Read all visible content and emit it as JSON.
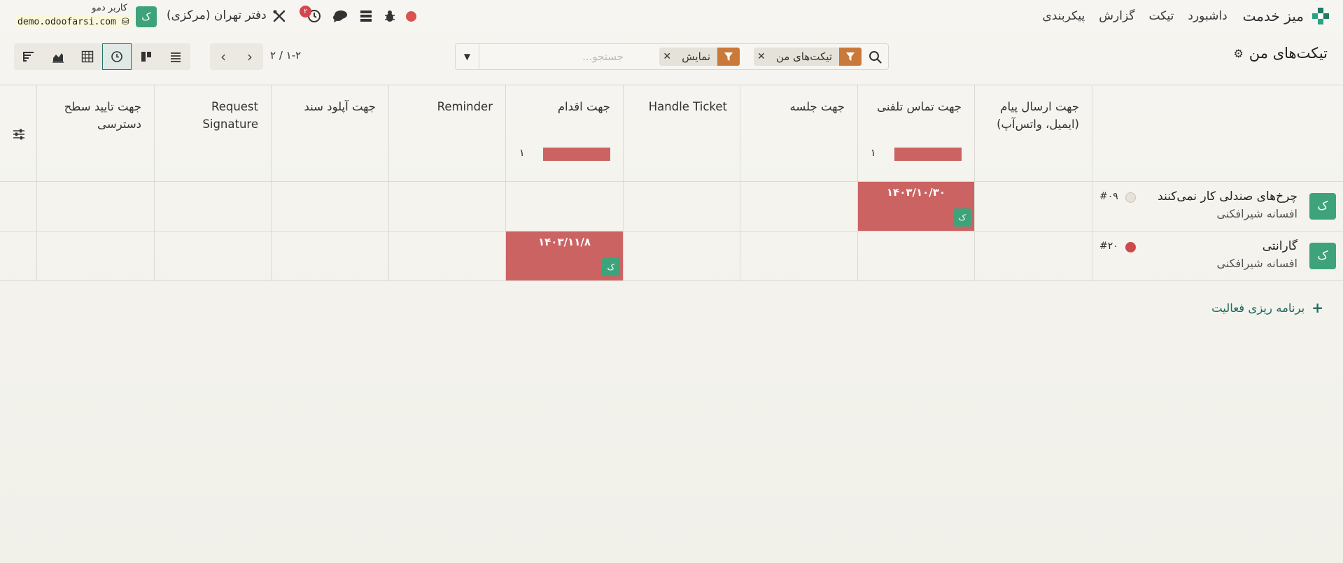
{
  "navbar": {
    "app_name": "میز خدمت",
    "menu": [
      "داشبورد",
      "تیکت",
      "گزارش",
      "پیکربندی"
    ],
    "company": "دفتر تهران (مرکزی)",
    "user_name": "کاربر دمو",
    "user_db": "demo.odoofarsi.com",
    "user_initial": "ک",
    "activity_badge": "۲",
    "colors": {
      "accent": "#3ea37a",
      "facet": "#c9793a",
      "overdue": "#cc6363"
    }
  },
  "control": {
    "title": "تیکت‌های من",
    "search_placeholder": "جستجو...",
    "facets": [
      {
        "label": "تیکت‌های من"
      },
      {
        "label": "نمایش"
      }
    ],
    "pager": "۱-۲ / ۲",
    "views": [
      "list-icon",
      "kanban-icon",
      "activity-icon",
      "pivot-icon",
      "graph-icon",
      "cohort-icon"
    ]
  },
  "grid": {
    "columns": [
      {
        "label": "جهت ارسال پیام (ایمیل، واتس‌آپ)",
        "count": "",
        "progress": 0
      },
      {
        "label": "جهت تماس تلفنی",
        "count": "۱",
        "progress": 1
      },
      {
        "label": "جهت جلسه",
        "count": "",
        "progress": 0
      },
      {
        "label": "Handle Ticket",
        "count": "",
        "progress": 0
      },
      {
        "label": "جهت اقدام",
        "count": "۱",
        "progress": 1
      },
      {
        "label": "Reminder",
        "count": "",
        "progress": 0
      },
      {
        "label": "جهت آپلود سند",
        "count": "",
        "progress": 0
      },
      {
        "label": "Request Signature",
        "count": "",
        "progress": 0
      },
      {
        "label": "جهت تایید سطح دسترسی",
        "count": "",
        "progress": 0
      }
    ],
    "rows": [
      {
        "name": "چرخ‌های صندلی کار نمی‌کنند",
        "customer": "افسانه شیرافکنی",
        "ref": "#۰۹",
        "avatar": "ک",
        "priority_color": "#e6e2d8",
        "activity": {
          "column": 1,
          "date": "۱۴۰۳/۱۰/۳۰",
          "avatar": "ک"
        }
      },
      {
        "name": "گارانتی",
        "customer": "افسانه شیرافکنی",
        "ref": "#۲۰",
        "avatar": "ک",
        "priority_color": "#cc4a4a",
        "activity": {
          "column": 4,
          "date": "۱۴۰۳/۱۱/۸",
          "avatar": "ک"
        }
      }
    ],
    "schedule_label": "برنامه ریزی فعالیت"
  }
}
